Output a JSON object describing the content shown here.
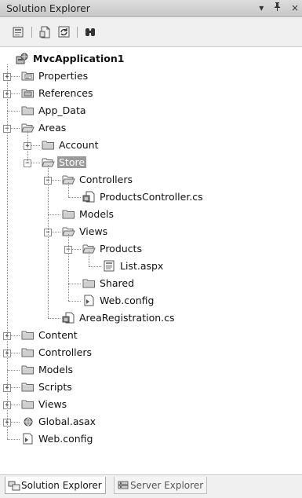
{
  "panel": {
    "title": "Solution Explorer",
    "dropdown_glyph": "▾",
    "pin_glyph": "ꟷ",
    "close_glyph": "×"
  },
  "toolbar": {
    "buttons": [
      {
        "icon": "properties-icon"
      },
      {
        "icon": "show-all-files-icon"
      },
      {
        "icon": "refresh-icon"
      },
      {
        "icon": "class-view-icon"
      }
    ]
  },
  "tree": {
    "nodes": [
      {
        "label": "MvcApplication1",
        "depth": 0,
        "icon": "project",
        "expander": null,
        "bold": true
      },
      {
        "label": "Properties",
        "depth": 1,
        "icon": "properties-folder",
        "expander": "+"
      },
      {
        "label": "References",
        "depth": 1,
        "icon": "references-folder",
        "expander": "+"
      },
      {
        "label": "App_Data",
        "depth": 1,
        "icon": "folder-closed",
        "expander": null
      },
      {
        "label": "Areas",
        "depth": 1,
        "icon": "folder-open",
        "expander": "-"
      },
      {
        "label": "Account",
        "depth": 2,
        "icon": "folder-closed",
        "expander": "+"
      },
      {
        "label": "Store",
        "depth": 2,
        "icon": "folder-open",
        "expander": "-",
        "selected": true
      },
      {
        "label": "Controllers",
        "depth": 3,
        "icon": "folder-open",
        "expander": "-"
      },
      {
        "label": "ProductsController.cs",
        "depth": 4,
        "icon": "cs-file",
        "expander": null
      },
      {
        "label": "Models",
        "depth": 3,
        "icon": "folder-closed",
        "expander": null
      },
      {
        "label": "Views",
        "depth": 3,
        "icon": "folder-open",
        "expander": "-"
      },
      {
        "label": "Products",
        "depth": 4,
        "icon": "folder-open",
        "expander": "-"
      },
      {
        "label": "List.aspx",
        "depth": 5,
        "icon": "aspx-file",
        "expander": null
      },
      {
        "label": "Shared",
        "depth": 4,
        "icon": "folder-closed",
        "expander": null
      },
      {
        "label": "Web.config",
        "depth": 4,
        "icon": "config-file",
        "expander": null
      },
      {
        "label": "AreaRegistration.cs",
        "depth": 3,
        "icon": "cs-file",
        "expander": null
      },
      {
        "label": "Content",
        "depth": 1,
        "icon": "folder-closed",
        "expander": "+"
      },
      {
        "label": "Controllers",
        "depth": 1,
        "icon": "folder-closed",
        "expander": "+"
      },
      {
        "label": "Models",
        "depth": 1,
        "icon": "folder-closed",
        "expander": null
      },
      {
        "label": "Scripts",
        "depth": 1,
        "icon": "folder-closed",
        "expander": "+"
      },
      {
        "label": "Views",
        "depth": 1,
        "icon": "folder-closed",
        "expander": "+"
      },
      {
        "label": "Global.asax",
        "depth": 1,
        "icon": "global-file",
        "expander": "+"
      },
      {
        "label": "Web.config",
        "depth": 1,
        "icon": "config-file",
        "expander": null
      }
    ]
  },
  "tabs": [
    {
      "label": "Solution Explorer",
      "active": true
    },
    {
      "label": "Server Explorer",
      "active": false
    }
  ]
}
